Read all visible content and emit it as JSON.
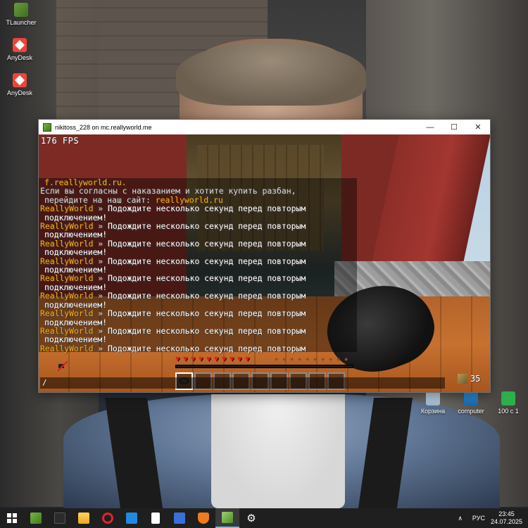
{
  "desktop": {
    "icons": [
      {
        "label": "TLauncher"
      },
      {
        "label": "AnyDesk"
      },
      {
        "label": "AnyDesk"
      },
      {
        "label": "Корзина"
      },
      {
        "label": "computer"
      },
      {
        "label": "100 с 1"
      }
    ]
  },
  "window": {
    "title": "nikitoss_228 on mc.reallyworld.me",
    "minimize": "—",
    "maximize": "☐",
    "close": "✕"
  },
  "game": {
    "fps": "176 FPS",
    "chat": {
      "intro": [
        {
          "text": "f.reallyworld.ru.",
          "color": "gold",
          "indent": true
        },
        {
          "text": "Если вы согласны с наказанием и хотите купить разбан,",
          "color": "gray",
          "indent": false
        }
      ],
      "site_prefix": "перейдите на наш сайт: ",
      "site_link": "reallyworld.ru",
      "server_name": "ReallyWorld",
      "separator": " » ",
      "message_part1": "Подождите несколько секунд перед повторым",
      "message_part2": "подключением!",
      "repeat_count": 9
    },
    "hud": {
      "health": 10,
      "hunger": 10,
      "hotbar_slots": 9,
      "selected_slot": 1,
      "block_count": "35"
    },
    "chat_input": "/"
  },
  "taskbar": {
    "lang": "РУС",
    "time": "23:45",
    "date": "24.07.2025"
  },
  "colors": {
    "gold": "#ffaa00",
    "heart": "#e0201b",
    "taskbar": "#1f1f1f"
  }
}
